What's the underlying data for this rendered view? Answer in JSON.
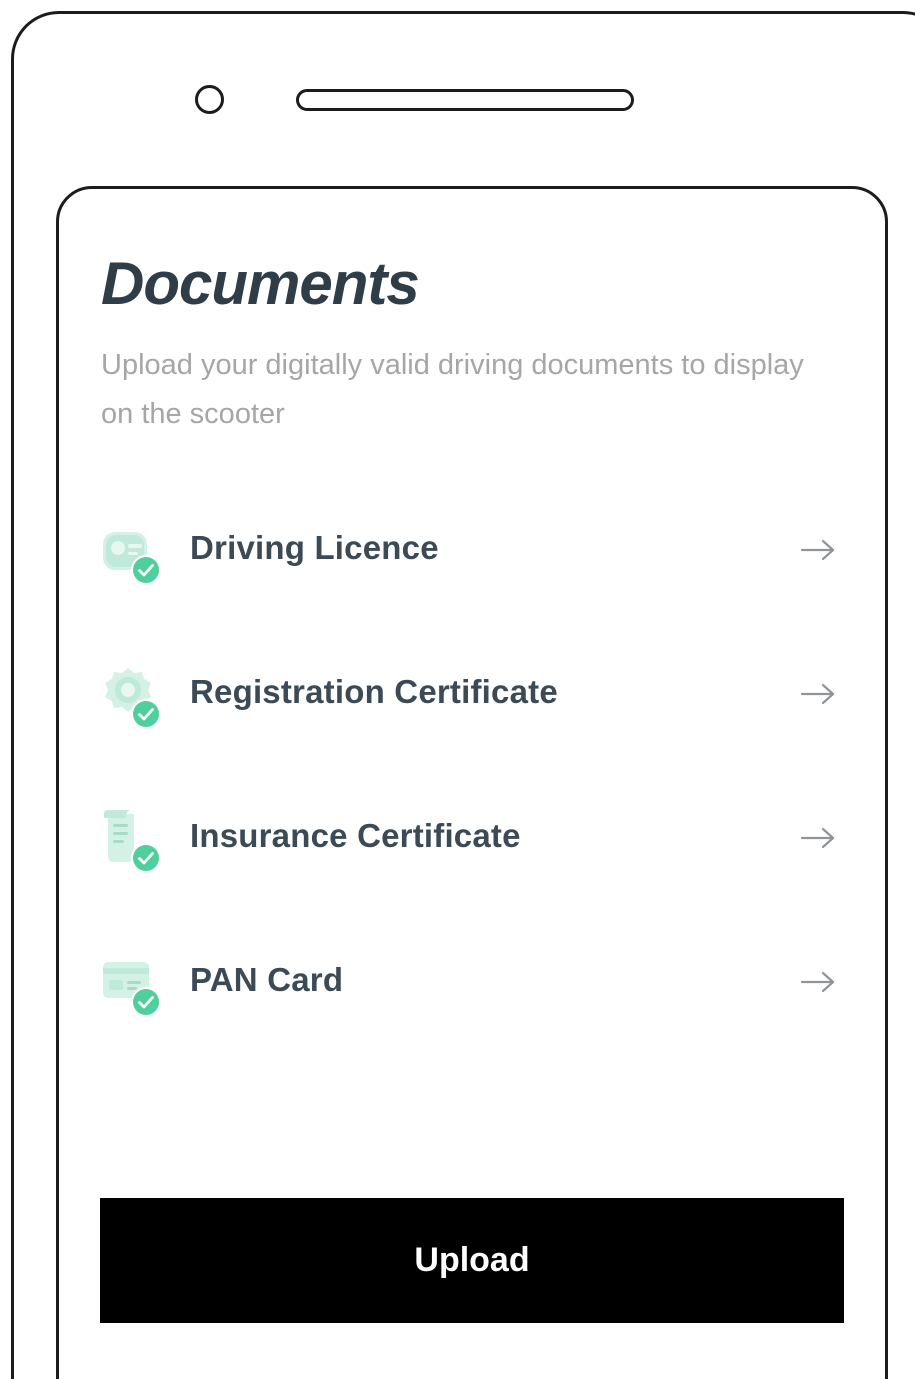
{
  "screen": {
    "title": "Documents",
    "subtitle": "Upload your digitally valid driving documents to display on the scooter"
  },
  "documents": [
    {
      "label": "Driving Licence",
      "icon": "driving-licence-verified-icon"
    },
    {
      "label": "Registration Certificate",
      "icon": "registration-certificate-verified-icon"
    },
    {
      "label": "Insurance Certificate",
      "icon": "insurance-certificate-verified-icon"
    },
    {
      "label": "PAN Card",
      "icon": "pan-card-verified-icon"
    }
  ],
  "actions": {
    "upload_label": "Upload"
  },
  "colors": {
    "title": "#2f3d48",
    "subtitle": "#a6a6a6",
    "item_label": "#3c4a55",
    "arrow": "#8e9498",
    "check_badge": "#4fcf9c",
    "icon_tint": "#cdeee3",
    "button_bg": "#000000",
    "button_text": "#ffffff",
    "device_outline": "#1c1c1c"
  }
}
